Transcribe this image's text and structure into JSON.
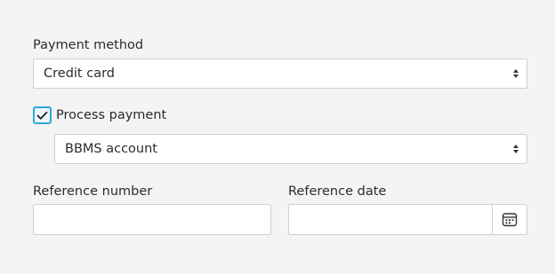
{
  "form": {
    "payment_method": {
      "label": "Payment method",
      "selected": "Credit card"
    },
    "process_payment": {
      "label": "Process payment",
      "checked": true
    },
    "account": {
      "selected": "BBMS account"
    },
    "reference_number": {
      "label": "Reference number",
      "value": ""
    },
    "reference_date": {
      "label": "Reference date",
      "value": "",
      "icon": "calendar-icon"
    }
  },
  "colors": {
    "background": "#f4f4f4",
    "field_border": "#cfcfcf",
    "checkbox_accent": "#2aa8d6",
    "text": "#2b2b2b"
  }
}
